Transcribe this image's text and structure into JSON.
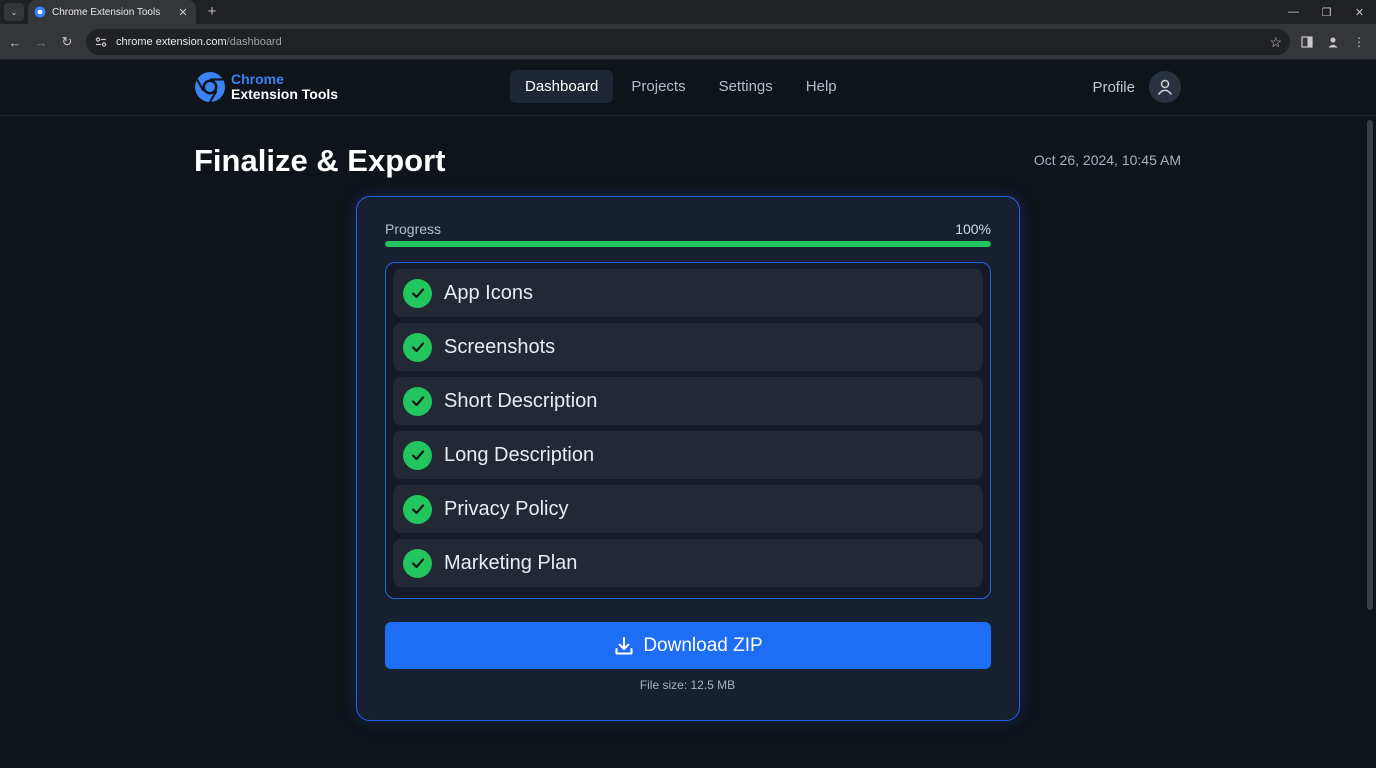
{
  "browser": {
    "tab_title": "Chrome Extension Tools",
    "url_host": "chrome extension.com",
    "url_path": "/dashboard"
  },
  "header": {
    "logo_line1": "Chrome",
    "logo_line2": "Extension Tools",
    "nav": [
      {
        "label": "Dashboard",
        "active": true
      },
      {
        "label": "Projects",
        "active": false
      },
      {
        "label": "Settings",
        "active": false
      },
      {
        "label": "Help",
        "active": false
      }
    ],
    "profile_label": "Profile"
  },
  "main": {
    "title": "Finalize & Export",
    "timestamp": "Oct 26, 2024, 10:45 AM"
  },
  "card": {
    "progress_label": "Progress",
    "progress_value": "100%",
    "progress_fraction": 1.0,
    "checklist": [
      {
        "label": "App Icons",
        "done": true
      },
      {
        "label": "Screenshots",
        "done": true
      },
      {
        "label": "Short Description",
        "done": true
      },
      {
        "label": "Long Description",
        "done": true
      },
      {
        "label": "Privacy Policy",
        "done": true
      },
      {
        "label": "Marketing Plan",
        "done": true
      }
    ],
    "download_label": "Download ZIP",
    "file_size": "File size: 12.5 MB"
  },
  "colors": {
    "accent": "#1d6ef5",
    "success": "#22c55e",
    "background": "#0f131a"
  }
}
